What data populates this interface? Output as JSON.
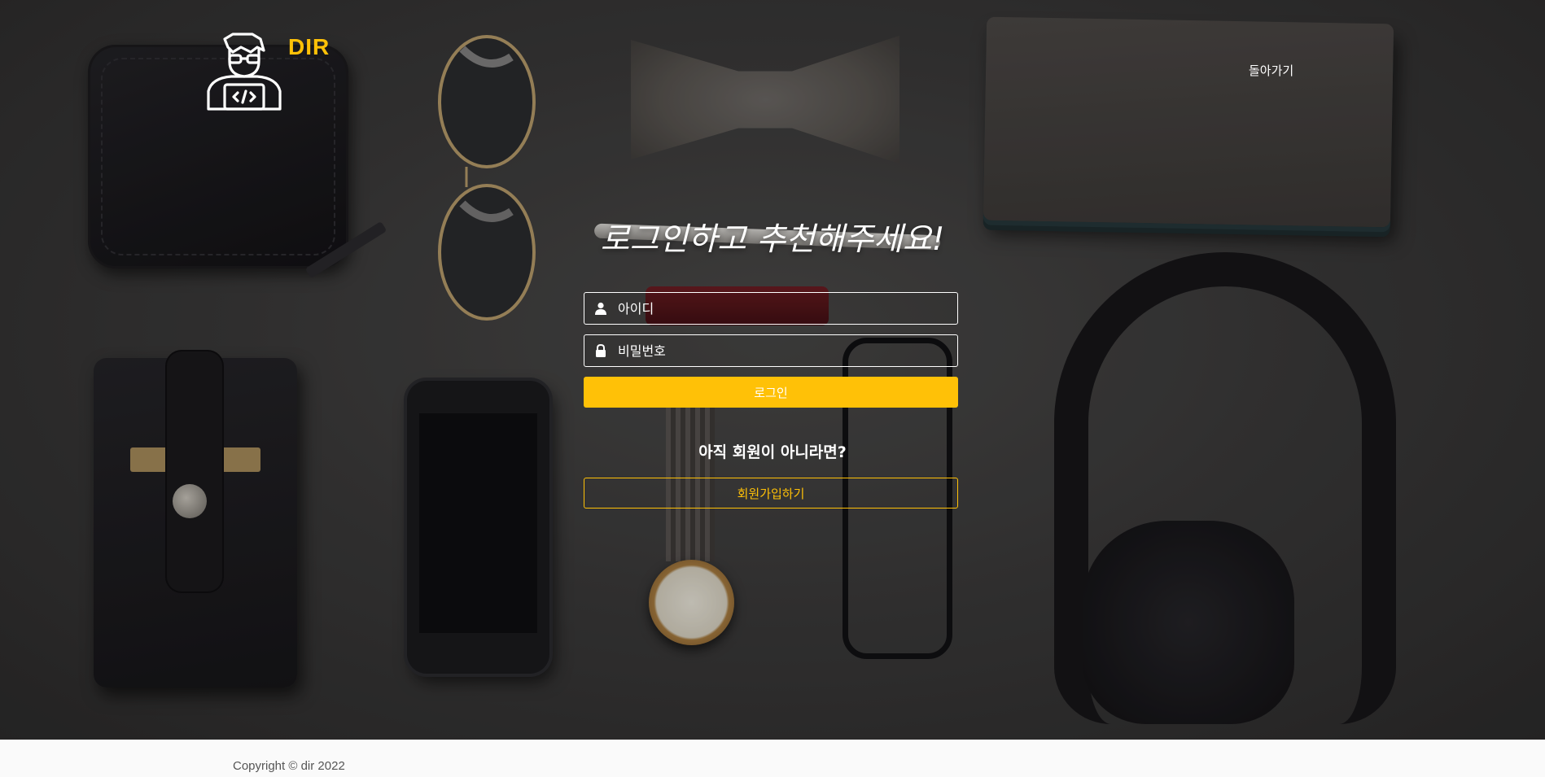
{
  "header": {
    "logo_text": "DIR",
    "back_link": "돌아가기"
  },
  "login": {
    "heading": "로그인하고 추천해주세요!",
    "id_placeholder": "아이디",
    "password_placeholder": "비밀번호",
    "login_button": "로그인",
    "not_member_text": "아직 회원이 아니라면?",
    "signup_button": "회원가입하기"
  },
  "footer": {
    "copyright": "Copyright © dir 2022"
  },
  "icons": {
    "logo": "developer-avatar-icon",
    "id_field": "user-icon",
    "password_field": "lock-icon"
  },
  "colors": {
    "accent": "#ffc107",
    "text_on_dark": "#ffffff",
    "footer_bg": "#fafafa"
  }
}
